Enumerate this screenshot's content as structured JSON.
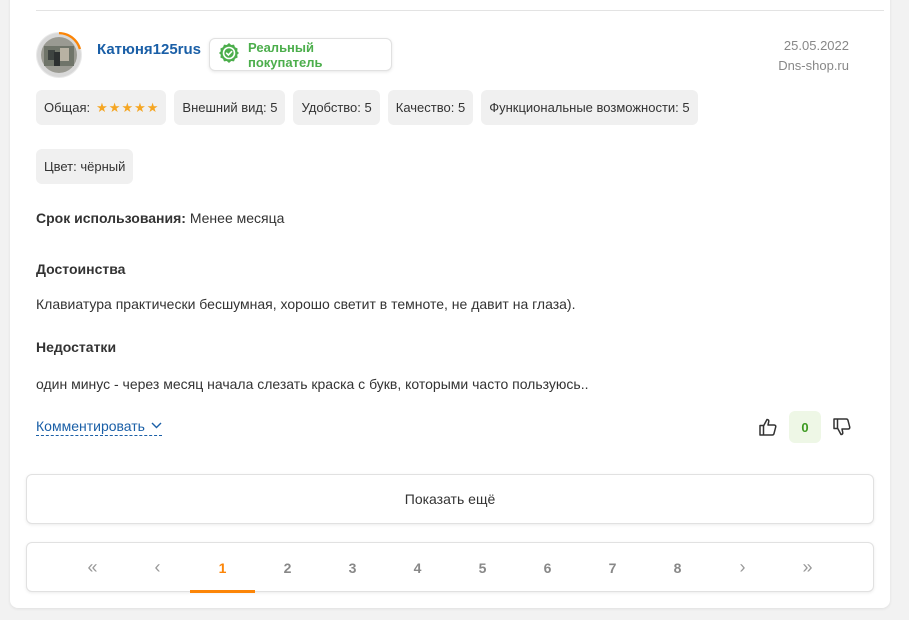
{
  "review": {
    "author": "Катюня125rus",
    "badge": "Реальный покупатель",
    "date": "25.05.2022",
    "source": "Dns-shop.ru",
    "ratings": [
      {
        "label": "Общая:",
        "stars": 5
      },
      {
        "label": "Внешний вид:",
        "value": "5"
      },
      {
        "label": "Удобство:",
        "value": "5"
      },
      {
        "label": "Качество:",
        "value": "5"
      },
      {
        "label": "Функциональные возможности:",
        "value": "5"
      }
    ],
    "color_chip": "Цвет: чёрный",
    "usage_label": "Срок использования:",
    "usage_value": "Менее месяца",
    "pros_title": "Достоинства",
    "pros_text": "Клавиатура практически бесшумная, хорошо светит в темноте, не давит на глаза).",
    "cons_title": "Недостатки",
    "cons_text": "один минус - через месяц начала слезать краска с букв, которыми часто пользуюсь..",
    "comment_label": "Комментировать",
    "votes": "0"
  },
  "show_more": "Показать ещё",
  "pagination": {
    "first": "«",
    "prev": "‹",
    "pages": [
      "1",
      "2",
      "3",
      "4",
      "5",
      "6",
      "7",
      "8"
    ],
    "active": "1",
    "next": "›",
    "last": "»"
  },
  "colors": {
    "link": "#1a5fa7",
    "badge_green": "#4cae4c",
    "accent_orange": "#fc8507",
    "star": "#f5a623"
  },
  "icons": {
    "badge": "check-circle-icon",
    "like": "thumbs-up-icon",
    "dislike": "thumbs-down-icon",
    "comment_chevron": "chevron-down-icon",
    "star": "star-icon"
  }
}
